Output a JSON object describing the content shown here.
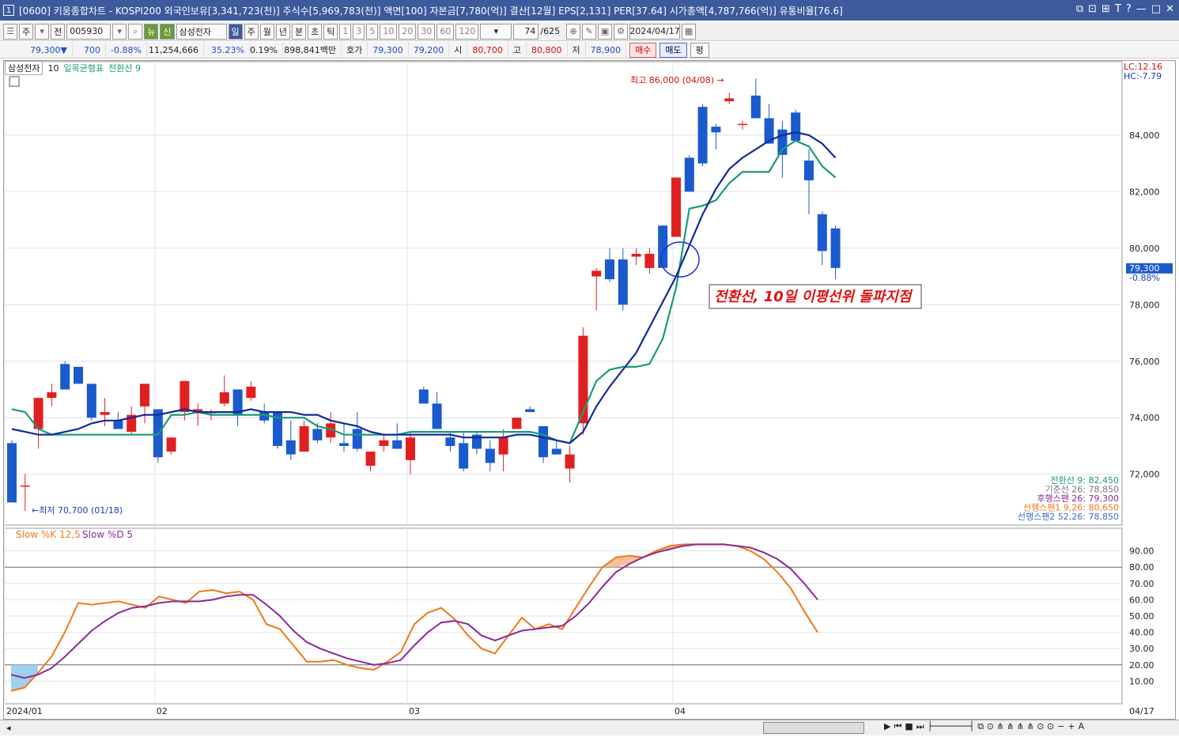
{
  "title": {
    "num": "1",
    "text": "[0600] 키움종합차트 - KOSPI200 외국인보유[3,341,723(천)] 주식수[5,969,783(천)] 액면[100] 자본금[7,780(억)] 결산[12월] EPS[2,131] PER[37.64] 시가총액[4,787,766(억)] 유통비율[76.6]"
  },
  "toolbar": {
    "period_label": "주",
    "prev_label": "전",
    "code": "005930",
    "name": "삼성전자",
    "new_tag": "뉴",
    "credit_tag": "신",
    "periods": [
      "일",
      "주",
      "월",
      "년",
      "분",
      "초",
      "틱"
    ],
    "intervals": [
      "1",
      "3",
      "5",
      "10",
      "20",
      "30",
      "60",
      "120"
    ],
    "count": "74",
    "total": "/625",
    "date": "2024/04/17"
  },
  "price": {
    "current": "79,300▼",
    "change": "700",
    "rate": "-0.88%",
    "volume": "11,254,666",
    "vol_rate": "35.23%",
    "turnover": "0.19%",
    "amount": "898,841백만",
    "hoga_label": "호가",
    "ask": "79,300",
    "bid": "79,200",
    "open_label": "시",
    "open": "80,700",
    "high_label": "고",
    "high": "80,800",
    "low_label": "저",
    "low": "78,900",
    "buy": "매수",
    "sell": "매도",
    "avg": "평"
  },
  "legend": {
    "stock": "삼성전자",
    "period": "10",
    "ichimoku": "일목균형표",
    "conv": "전환선 9"
  },
  "annotations": {
    "high": "최고 86,000 (04/08)",
    "low": "최저 70,700 (01/18)",
    "note": "전환선, 10일 이평선위 돌파지점"
  },
  "right_info": {
    "lc": "LC:12.16",
    "hc": "HC:-7.79",
    "last": "79,300",
    "last_rate": "-0.88%"
  },
  "ichimoku_vals": [
    "전환선 9: 82,450",
    "기준선 26: 78,850",
    "후행스팬 26: 79,300",
    "선행스팬1 9,26: 80,650",
    "선행스팬2 52,26: 78,850"
  ],
  "stoch_legend": {
    "k": "Slow %K 12,5",
    "d": "Slow %D 5"
  },
  "colors": {
    "up": "#e02020",
    "down": "#1a5acd",
    "ma": "#102a9a",
    "conv": "#1a9a78",
    "k": "#f07818",
    "d": "#8a2a9a"
  },
  "chart_data": {
    "type": "candlestick",
    "y_ticks": [
      72000,
      74000,
      76000,
      78000,
      80000,
      82000,
      84000
    ],
    "y_tick_labels": [
      "72,000",
      "74,000",
      "76,000",
      "78,000",
      "80,000",
      "82,000",
      "84,000"
    ],
    "ylim": [
      70200,
      86600
    ],
    "x_labels": [
      {
        "i": 0,
        "t": "2024/01"
      },
      {
        "i": 11,
        "t": "02"
      },
      {
        "i": 30,
        "t": "03"
      },
      {
        "i": 50,
        "t": "04"
      }
    ],
    "x_last": "04/17",
    "candles": [
      [
        73100,
        73200,
        71000,
        71000
      ],
      [
        71600,
        72000,
        70700,
        71600
      ],
      [
        73600,
        74700,
        72900,
        74700
      ],
      [
        74700,
        75200,
        74400,
        74900
      ],
      [
        75900,
        76000,
        75000,
        75000
      ],
      [
        75800,
        75800,
        75200,
        75200
      ],
      [
        75200,
        75200,
        73900,
        74000
      ],
      [
        74100,
        74700,
        73700,
        74200
      ],
      [
        73900,
        74200,
        73600,
        73600
      ],
      [
        73500,
        74400,
        73400,
        74100
      ],
      [
        74400,
        75200,
        73800,
        75200
      ],
      [
        74300,
        74300,
        72400,
        72600
      ],
      [
        72800,
        73200,
        72700,
        73300
      ],
      [
        74200,
        75300,
        73900,
        75300
      ],
      [
        74200,
        74500,
        73700,
        74300
      ],
      [
        74200,
        74300,
        73900,
        74200
      ],
      [
        74500,
        75500,
        74400,
        74900
      ],
      [
        75000,
        75000,
        73700,
        74100
      ],
      [
        74700,
        75300,
        74600,
        75100
      ],
      [
        74200,
        74500,
        73800,
        73900
      ],
      [
        74200,
        74200,
        72900,
        73000
      ],
      [
        73200,
        73900,
        72500,
        72700
      ],
      [
        72800,
        73900,
        72800,
        73700
      ],
      [
        73600,
        73800,
        73100,
        73200
      ],
      [
        73300,
        74200,
        73100,
        73800
      ],
      [
        73100,
        73800,
        72800,
        73000
      ],
      [
        73600,
        74200,
        72800,
        72900
      ],
      [
        72300,
        72700,
        72100,
        72800
      ],
      [
        73000,
        73400,
        72800,
        73200
      ],
      [
        73200,
        73800,
        73000,
        72900
      ],
      [
        72500,
        73500,
        72000,
        73300
      ],
      [
        75000,
        75100,
        74500,
        74500
      ],
      [
        74500,
        74900,
        73600,
        73600
      ],
      [
        73300,
        73500,
        72800,
        73000
      ],
      [
        73100,
        73500,
        72100,
        72200
      ],
      [
        73400,
        73500,
        72700,
        72900
      ],
      [
        72900,
        73200,
        72100,
        72400
      ],
      [
        72700,
        73600,
        72100,
        73300
      ],
      [
        73600,
        74000,
        73600,
        74000
      ],
      [
        74300,
        74400,
        74200,
        74200
      ],
      [
        73700,
        73700,
        72400,
        72600
      ],
      [
        72900,
        73200,
        72800,
        72700
      ],
      [
        72200,
        73000,
        71700,
        72700
      ],
      [
        73800,
        77200,
        73400,
        76900
      ],
      [
        79000,
        79300,
        77800,
        79200
      ],
      [
        79600,
        80000,
        78800,
        78900
      ],
      [
        79600,
        80000,
        77800,
        78000
      ],
      [
        79700,
        80000,
        79400,
        79800
      ],
      [
        79300,
        80000,
        79100,
        79800
      ],
      [
        80800,
        80800,
        79300,
        79300
      ],
      [
        80400,
        82500,
        80400,
        82500
      ],
      [
        83200,
        83300,
        82000,
        82000
      ],
      [
        85000,
        85100,
        82900,
        83000
      ],
      [
        84300,
        84400,
        83500,
        84100
      ],
      [
        85200,
        85500,
        85100,
        85300
      ],
      [
        84400,
        84500,
        84200,
        84400
      ],
      [
        85400,
        86000,
        84600,
        84600
      ],
      [
        84600,
        85100,
        83700,
        83700
      ],
      [
        84200,
        84500,
        82500,
        83300
      ],
      [
        84800,
        84900,
        83800,
        83800
      ],
      [
        83100,
        83500,
        81200,
        82400
      ],
      [
        81200,
        81300,
        79400,
        79900
      ],
      [
        80700,
        80800,
        78900,
        79300
      ]
    ],
    "ma10": [
      73600,
      73500,
      73400,
      73400,
      73500,
      73600,
      73800,
      73900,
      73900,
      74000,
      74100,
      74100,
      74200,
      74300,
      74200,
      74200,
      74200,
      74200,
      74300,
      74200,
      74200,
      74200,
      74100,
      74100,
      73900,
      73800,
      73700,
      73500,
      73400,
      73400,
      73400,
      73400,
      73400,
      73400,
      73300,
      73300,
      73300,
      73300,
      73400,
      73400,
      73300,
      73200,
      73100,
      73500,
      74400,
      75100,
      75700,
      76300,
      77200,
      78100,
      79000,
      80100,
      81200,
      82100,
      82800,
      83200,
      83500,
      83800,
      84000,
      84100,
      84000,
      83700,
      83200
    ],
    "conv": [
      74300,
      74200,
      73600,
      73400,
      73400,
      73400,
      73400,
      73400,
      73400,
      73400,
      73400,
      73400,
      74100,
      74100,
      74200,
      74100,
      74100,
      74100,
      74100,
      74100,
      74000,
      74000,
      74000,
      73700,
      73600,
      73400,
      73400,
      73400,
      73400,
      73400,
      73500,
      73500,
      73500,
      73500,
      73500,
      73500,
      73500,
      73500,
      73500,
      73500,
      73400,
      73200,
      73100,
      74200,
      75300,
      75700,
      75800,
      75800,
      75900,
      76800,
      78600,
      81400,
      81500,
      81700,
      82300,
      82700,
      82700,
      82700,
      83500,
      83800,
      83600,
      82900,
      82500
    ],
    "slowk": [
      4,
      6,
      15,
      25,
      40,
      58,
      57,
      58,
      59,
      57,
      55,
      62,
      60,
      58,
      65,
      66,
      64,
      65,
      60,
      45,
      42,
      32,
      22,
      22,
      23,
      20,
      18,
      17,
      22,
      28,
      45,
      52,
      55,
      48,
      38,
      30,
      27,
      38,
      49,
      42,
      45,
      42,
      55,
      68,
      80,
      86,
      87,
      86,
      90,
      93,
      94,
      94,
      94,
      94,
      93,
      90,
      85,
      77,
      67,
      53,
      40
    ],
    "slowd": [
      14,
      12,
      14,
      18,
      25,
      33,
      41,
      47,
      52,
      55,
      56,
      58,
      59,
      59,
      59,
      60,
      62,
      63,
      63,
      57,
      50,
      41,
      34,
      30,
      27,
      24,
      22,
      20,
      21,
      23,
      32,
      40,
      46,
      47,
      45,
      38,
      35,
      38,
      41,
      42,
      43,
      44,
      50,
      58,
      68,
      77,
      82,
      86,
      89,
      91,
      93,
      94,
      94,
      94,
      93,
      92,
      89,
      85,
      79,
      70,
      60
    ]
  }
}
